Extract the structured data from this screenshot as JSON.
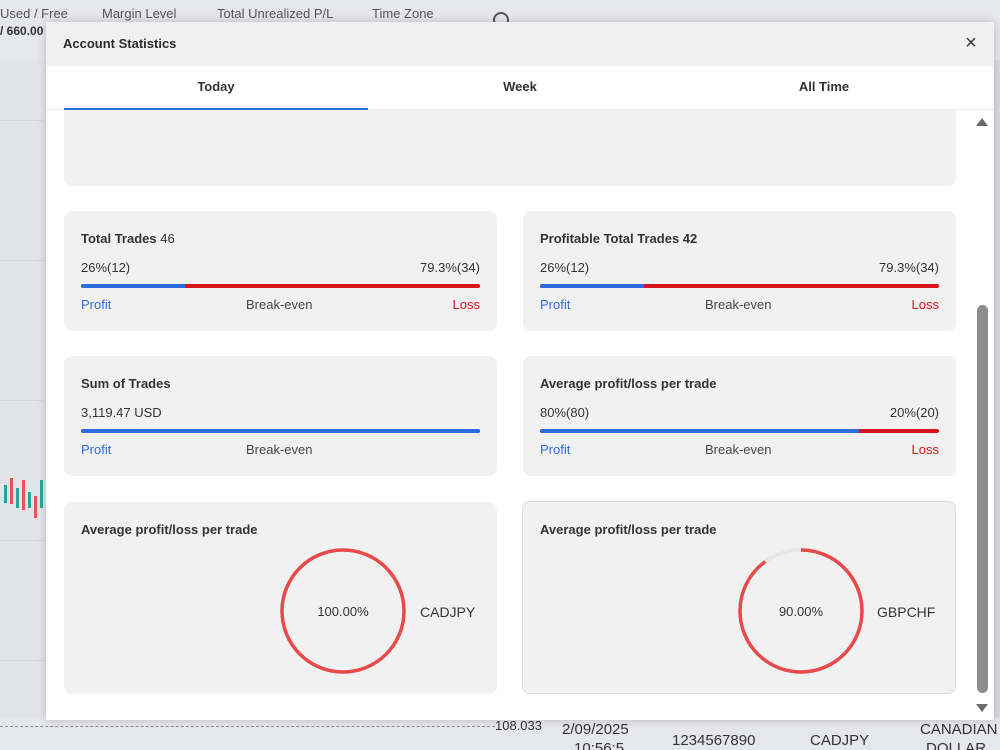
{
  "background": {
    "columns": [
      "Used / Free",
      "Margin Level",
      "Total Unrealized P/L",
      "Time Zone"
    ],
    "used_free_value": "/ 660.00",
    "bottom_row": {
      "price": "108.033",
      "date": "2/09/2025",
      "time": "10:56:5",
      "account": "1234567890",
      "symbol": "CADJPY",
      "currency": "CANADIAN",
      "currency_2": "DOLLAR"
    }
  },
  "modal": {
    "title": "Account Statistics",
    "close_glyph": "×",
    "tabs": [
      {
        "label": "Today",
        "active": true
      },
      {
        "label": "Week",
        "active": false
      },
      {
        "label": "All Time",
        "active": false
      }
    ]
  },
  "cards": {
    "total_trades": {
      "title": "Total Trades",
      "count": "46",
      "left_value": "26%(12)",
      "right_value": "79.3%(34)",
      "profit_fraction": 0.26,
      "profit_label": "Profit",
      "break_label": "Break-even",
      "loss_label": "Loss"
    },
    "profitable_total_trades": {
      "title": "Profitable Total Trades 42",
      "left_value": "26%(12)",
      "right_value": "79.3%(34)",
      "profit_fraction": 0.26,
      "profit_label": "Profit",
      "break_label": "Break-even",
      "loss_label": "Loss"
    },
    "sum_of_trades": {
      "title": "Sum of Trades",
      "left_value": "3,119.47 USD",
      "profit_fraction": 1.0,
      "profit_label": "Profit",
      "break_label": "Break-even"
    },
    "avg_pl_bar": {
      "title": "Average profit/loss per trade",
      "left_value": "80%(80)",
      "right_value": "20%(20)",
      "profit_fraction": 0.8,
      "profit_label": "Profit",
      "break_label": "Break-even",
      "loss_label": "Loss"
    },
    "avg_pl_ring_1": {
      "title": "Average profit/loss per trade",
      "percent_label": "100.00%",
      "fraction": 1.0,
      "pair": "CADJPY"
    },
    "avg_pl_ring_2": {
      "title": "Average profit/loss per trade",
      "percent_label": "90.00%",
      "fraction": 0.9,
      "pair": "GBPCHF"
    }
  },
  "colors": {
    "profit": "#2d6cdf",
    "loss": "#d8131b",
    "ring": "#e84a4a",
    "ring_track": "#e6e6e6"
  }
}
